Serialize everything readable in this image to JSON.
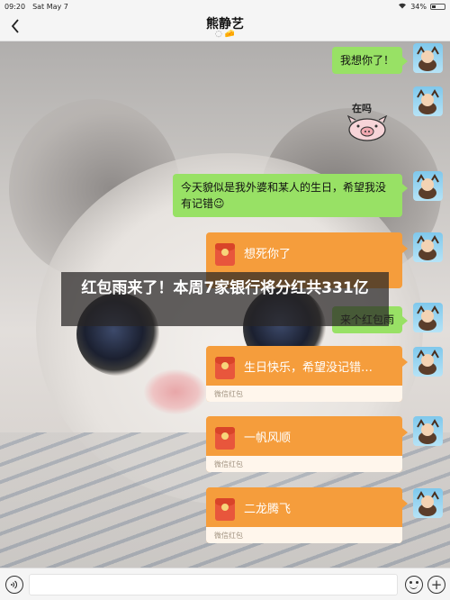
{
  "status_bar": {
    "time": "09:20",
    "date": "Sat May 7",
    "battery": "34%",
    "battery_level": 0.34
  },
  "header": {
    "title": "熊静艺",
    "subtitle": "◌ 🧀"
  },
  "messages": [
    {
      "type": "text",
      "text": "我想你了！"
    },
    {
      "type": "sticker",
      "text": "在吗"
    },
    {
      "type": "text",
      "text": "今天貌似是我外婆和某人的生日，希望我没有记错😉"
    },
    {
      "type": "red_packet",
      "text": "想死你了",
      "footer": ""
    },
    {
      "type": "text",
      "text": "来个红包雨"
    },
    {
      "type": "red_packet",
      "text": "生日快乐，希望没记错…",
      "footer": "微信红包"
    },
    {
      "type": "red_packet",
      "text": "一帆风顺",
      "footer": "微信红包"
    },
    {
      "type": "red_packet",
      "text": "二龙腾飞",
      "footer": "微信红包"
    }
  ],
  "overlay": {
    "headline": "红包雨来了！本周7家银行将分红共331亿"
  },
  "colors": {
    "green_bubble": "#98e165",
    "red_packet": "#f59d3c",
    "overlay": "#282626"
  },
  "icons": {
    "voice": "voice-icon",
    "emoji": "emoji-icon",
    "plus": "plus-icon",
    "back": "chevron-left-icon"
  }
}
